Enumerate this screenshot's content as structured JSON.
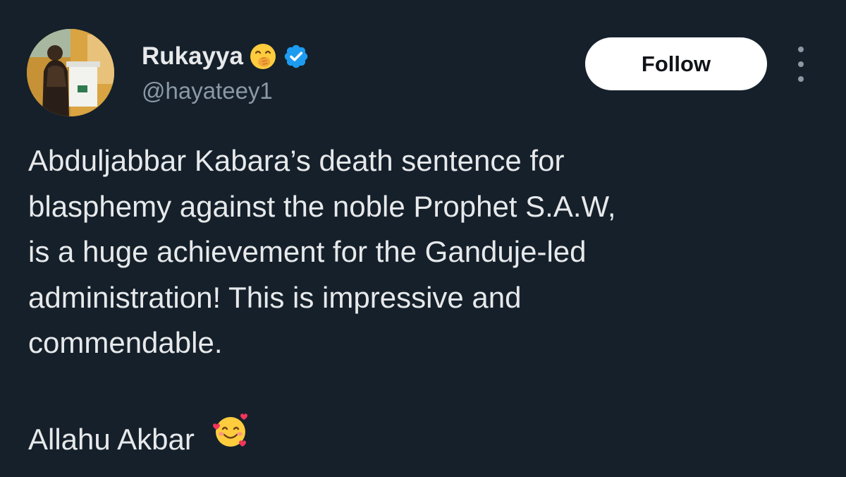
{
  "tweet": {
    "author": {
      "display_name": "Rukayya",
      "handle": "@hayateey1",
      "name_emoji": "face-with-hand-over-mouth-emoji",
      "verified_icon": "verified-badge-icon",
      "avatar": "profile-avatar"
    },
    "follow_label": "Follow",
    "more_icon": "more-options-icon",
    "body_lines": [
      "Abduljabbar Kabara’s death sentence for",
      "blasphemy against the noble Prophet S.A.W,",
      "is a huge achievement for the Ganduje-led",
      "administration! This is impressive and",
      "commendable."
    ],
    "closing_text": "Allahu Akbar",
    "closing_emoji": "smiling-face-with-hearts-emoji"
  },
  "colors": {
    "background": "#15202b",
    "text_primary": "#e7e9ea",
    "text_secondary": "#8b98a5",
    "verified_blue": "#1d9bf0",
    "follow_bg": "#ffffff"
  }
}
